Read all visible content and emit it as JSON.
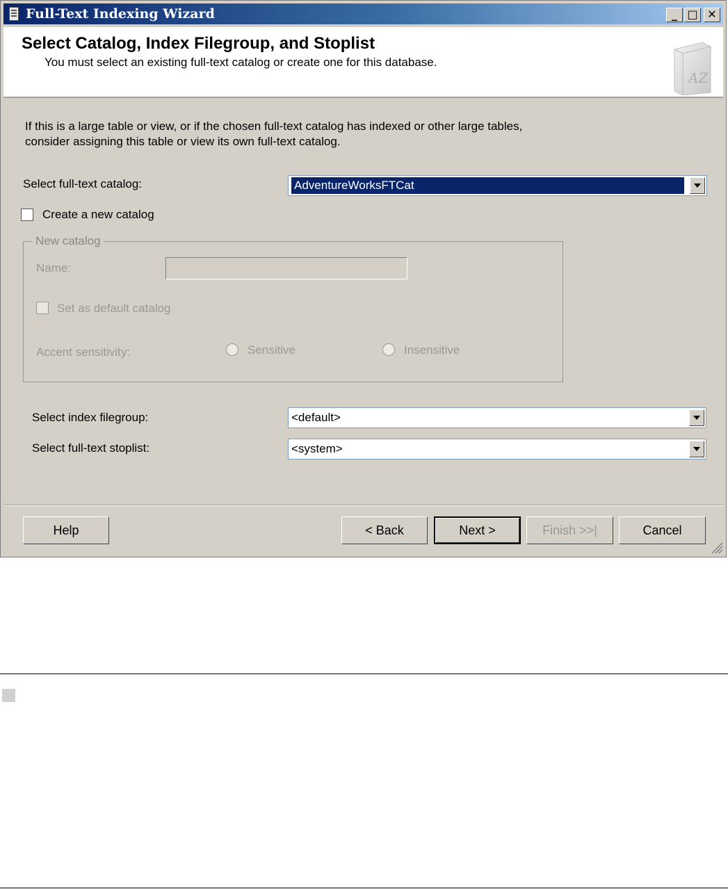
{
  "window": {
    "title": "Full-Text Indexing Wizard",
    "controls": {
      "minimize": "_",
      "maximize": "□",
      "close": "✕"
    }
  },
  "header": {
    "title": "Select Catalog, Index Filegroup, and Stoplist",
    "subtitle": "You must select an existing full-text catalog or create one for this database.",
    "icon": "book-az-icon",
    "icon_text": "AZ"
  },
  "intro_text": "If this is a large table or view, or if the chosen full-text catalog has indexed or other large tables, consider assigning this table or view its own full-text catalog.",
  "catalog": {
    "label": "Select full-text catalog:",
    "value": "AdventureWorksFTCat"
  },
  "create_new_catalog": {
    "label": "Create a new catalog",
    "checked": false
  },
  "new_catalog_group": {
    "legend": "New catalog",
    "name_label": "Name:",
    "name_value": "",
    "default_label": "Set as default catalog",
    "accent_label": "Accent sensitivity:",
    "sensitive_label": "Sensitive",
    "insensitive_label": "Insensitive"
  },
  "filegroup": {
    "label": "Select index filegroup:",
    "value": "<default>"
  },
  "stoplist": {
    "label": "Select full-text stoplist:",
    "value": "<system>"
  },
  "buttons": {
    "help": "Help",
    "back": "< Back",
    "next": "Next >",
    "finish": "Finish >>|",
    "cancel": "Cancel"
  },
  "colors": {
    "title_bar": "#0a246a",
    "dialog_background": "#d4d0c8",
    "selection": "#0a246a"
  }
}
